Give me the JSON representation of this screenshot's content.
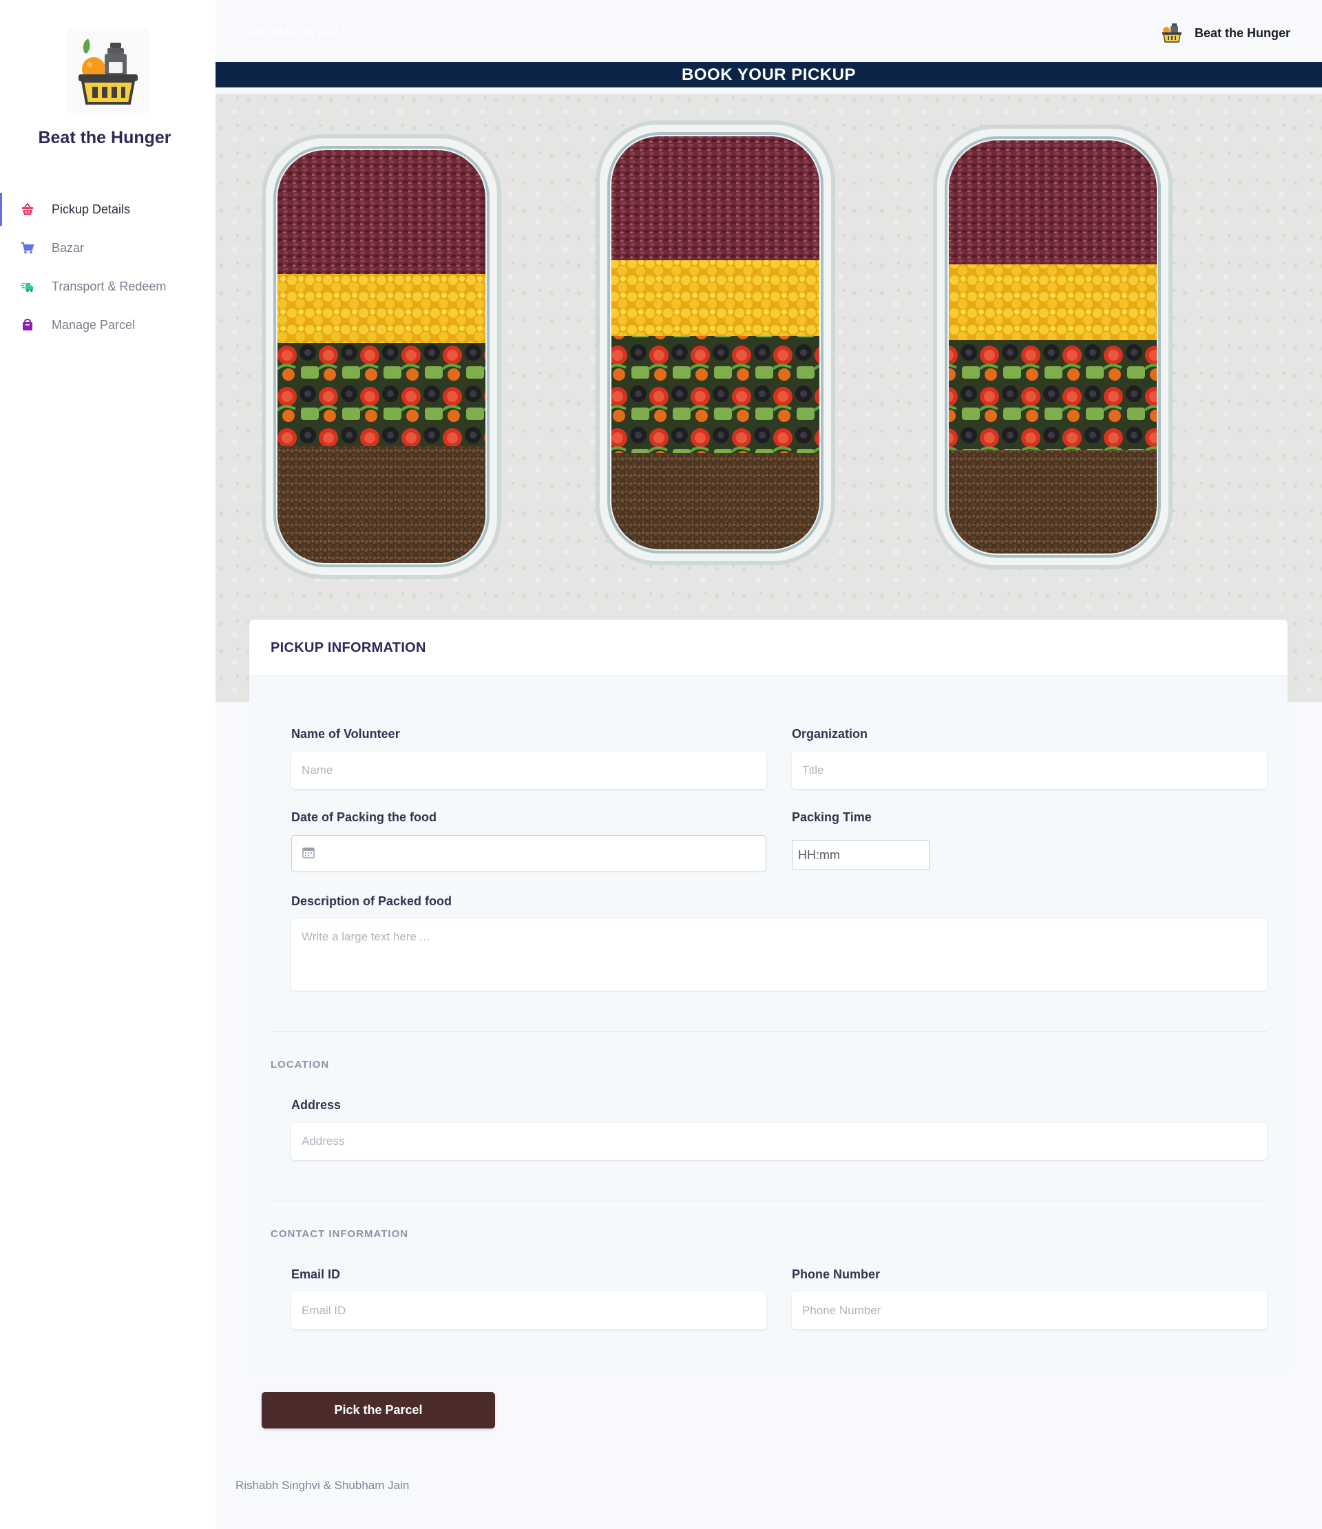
{
  "app": {
    "brand": "Beat the Hunger",
    "breadcrumb": "PICKUPDETAILS"
  },
  "topbar": {
    "user_name": "Beat the Hunger"
  },
  "sidebar": {
    "items": [
      {
        "label": "Pickup Details",
        "icon": "basket-icon",
        "color": "#f5365c",
        "active": true
      },
      {
        "label": "Bazar",
        "icon": "cart-icon",
        "color": "#5e72e4",
        "active": false
      },
      {
        "label": "Transport & Redeem",
        "icon": "delivery-truck-icon",
        "color": "#2dce89",
        "active": false
      },
      {
        "label": "Manage Parcel",
        "icon": "parcel-bag-icon",
        "color": "#8e1db8",
        "active": false
      }
    ]
  },
  "banner": {
    "title": "BOOK YOUR PICKUP"
  },
  "hero": {
    "image": "meal-prep-containers-photo"
  },
  "form": {
    "title": "PICKUP INFORMATION",
    "volunteer": {
      "label": "Name of Volunteer",
      "placeholder": "Name"
    },
    "organization": {
      "label": "Organization",
      "placeholder": "Title"
    },
    "packing_date": {
      "label": "Date of Packing the food",
      "value": ""
    },
    "packing_time": {
      "label": "Packing Time",
      "placeholder": "HH:mm"
    },
    "description": {
      "label": "Description of Packed food",
      "placeholder": "Write a large text here ..."
    },
    "location": {
      "heading": "LOCATION",
      "address": {
        "label": "Address",
        "placeholder": "Address"
      }
    },
    "contact": {
      "heading": "CONTACT INFORMATION",
      "email": {
        "label": "Email ID",
        "placeholder": "Email ID"
      },
      "phone": {
        "label": "Phone Number",
        "placeholder": "Phone Number"
      }
    }
  },
  "actions": {
    "submit_label": "Pick the Parcel"
  },
  "footer": {
    "credits": "Rishabh Singhvi & Shubham Jain"
  },
  "colors": {
    "banner_bg": "#0c2447",
    "submit_bg": "#4c2c2a",
    "active_indicator": "#5e72e4",
    "heading_text": "#2d2a5a"
  }
}
